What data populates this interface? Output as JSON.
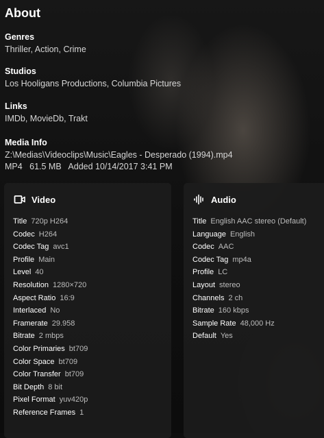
{
  "about": {
    "title": "About",
    "genres": {
      "label": "Genres",
      "value": "Thriller, Action, Crime"
    },
    "studios": {
      "label": "Studios",
      "value": "Los Hooligans Productions, Columbia Pictures"
    },
    "links": {
      "label": "Links",
      "value": "IMDb, MovieDb, Trakt"
    },
    "media_info": {
      "label": "Media Info",
      "path": "Z:\\Medias\\Videoclips\\Music\\Eagles - Desperado (1994).mp4",
      "summary": "MP4   61.5 MB   Added 10/14/2017 3:41 PM"
    }
  },
  "video": {
    "title": "Video",
    "icon": "video-camera-icon",
    "rows": [
      {
        "k": "Title",
        "v": "720p H264"
      },
      {
        "k": "Codec",
        "v": "H264"
      },
      {
        "k": "Codec Tag",
        "v": "avc1"
      },
      {
        "k": "Profile",
        "v": "Main"
      },
      {
        "k": "Level",
        "v": "40"
      },
      {
        "k": "Resolution",
        "v": "1280×720"
      },
      {
        "k": "Aspect Ratio",
        "v": "16:9"
      },
      {
        "k": "Interlaced",
        "v": "No"
      },
      {
        "k": "Framerate",
        "v": "29.958"
      },
      {
        "k": "Bitrate",
        "v": "2 mbps"
      },
      {
        "k": "Color Primaries",
        "v": "bt709"
      },
      {
        "k": "Color Space",
        "v": "bt709"
      },
      {
        "k": "Color Transfer",
        "v": "bt709"
      },
      {
        "k": "Bit Depth",
        "v": "8 bit"
      },
      {
        "k": "Pixel Format",
        "v": "yuv420p"
      },
      {
        "k": "Reference Frames",
        "v": "1"
      }
    ]
  },
  "audio": {
    "title": "Audio",
    "icon": "audio-waveform-icon",
    "rows": [
      {
        "k": "Title",
        "v": "English AAC stereo (Default)"
      },
      {
        "k": "Language",
        "v": "English"
      },
      {
        "k": "Codec",
        "v": "AAC"
      },
      {
        "k": "Codec Tag",
        "v": "mp4a"
      },
      {
        "k": "Profile",
        "v": "LC"
      },
      {
        "k": "Layout",
        "v": "stereo"
      },
      {
        "k": "Channels",
        "v": "2 ch"
      },
      {
        "k": "Bitrate",
        "v": "160 kbps"
      },
      {
        "k": "Sample Rate",
        "v": "48,000 Hz"
      },
      {
        "k": "Default",
        "v": "Yes"
      }
    ]
  }
}
